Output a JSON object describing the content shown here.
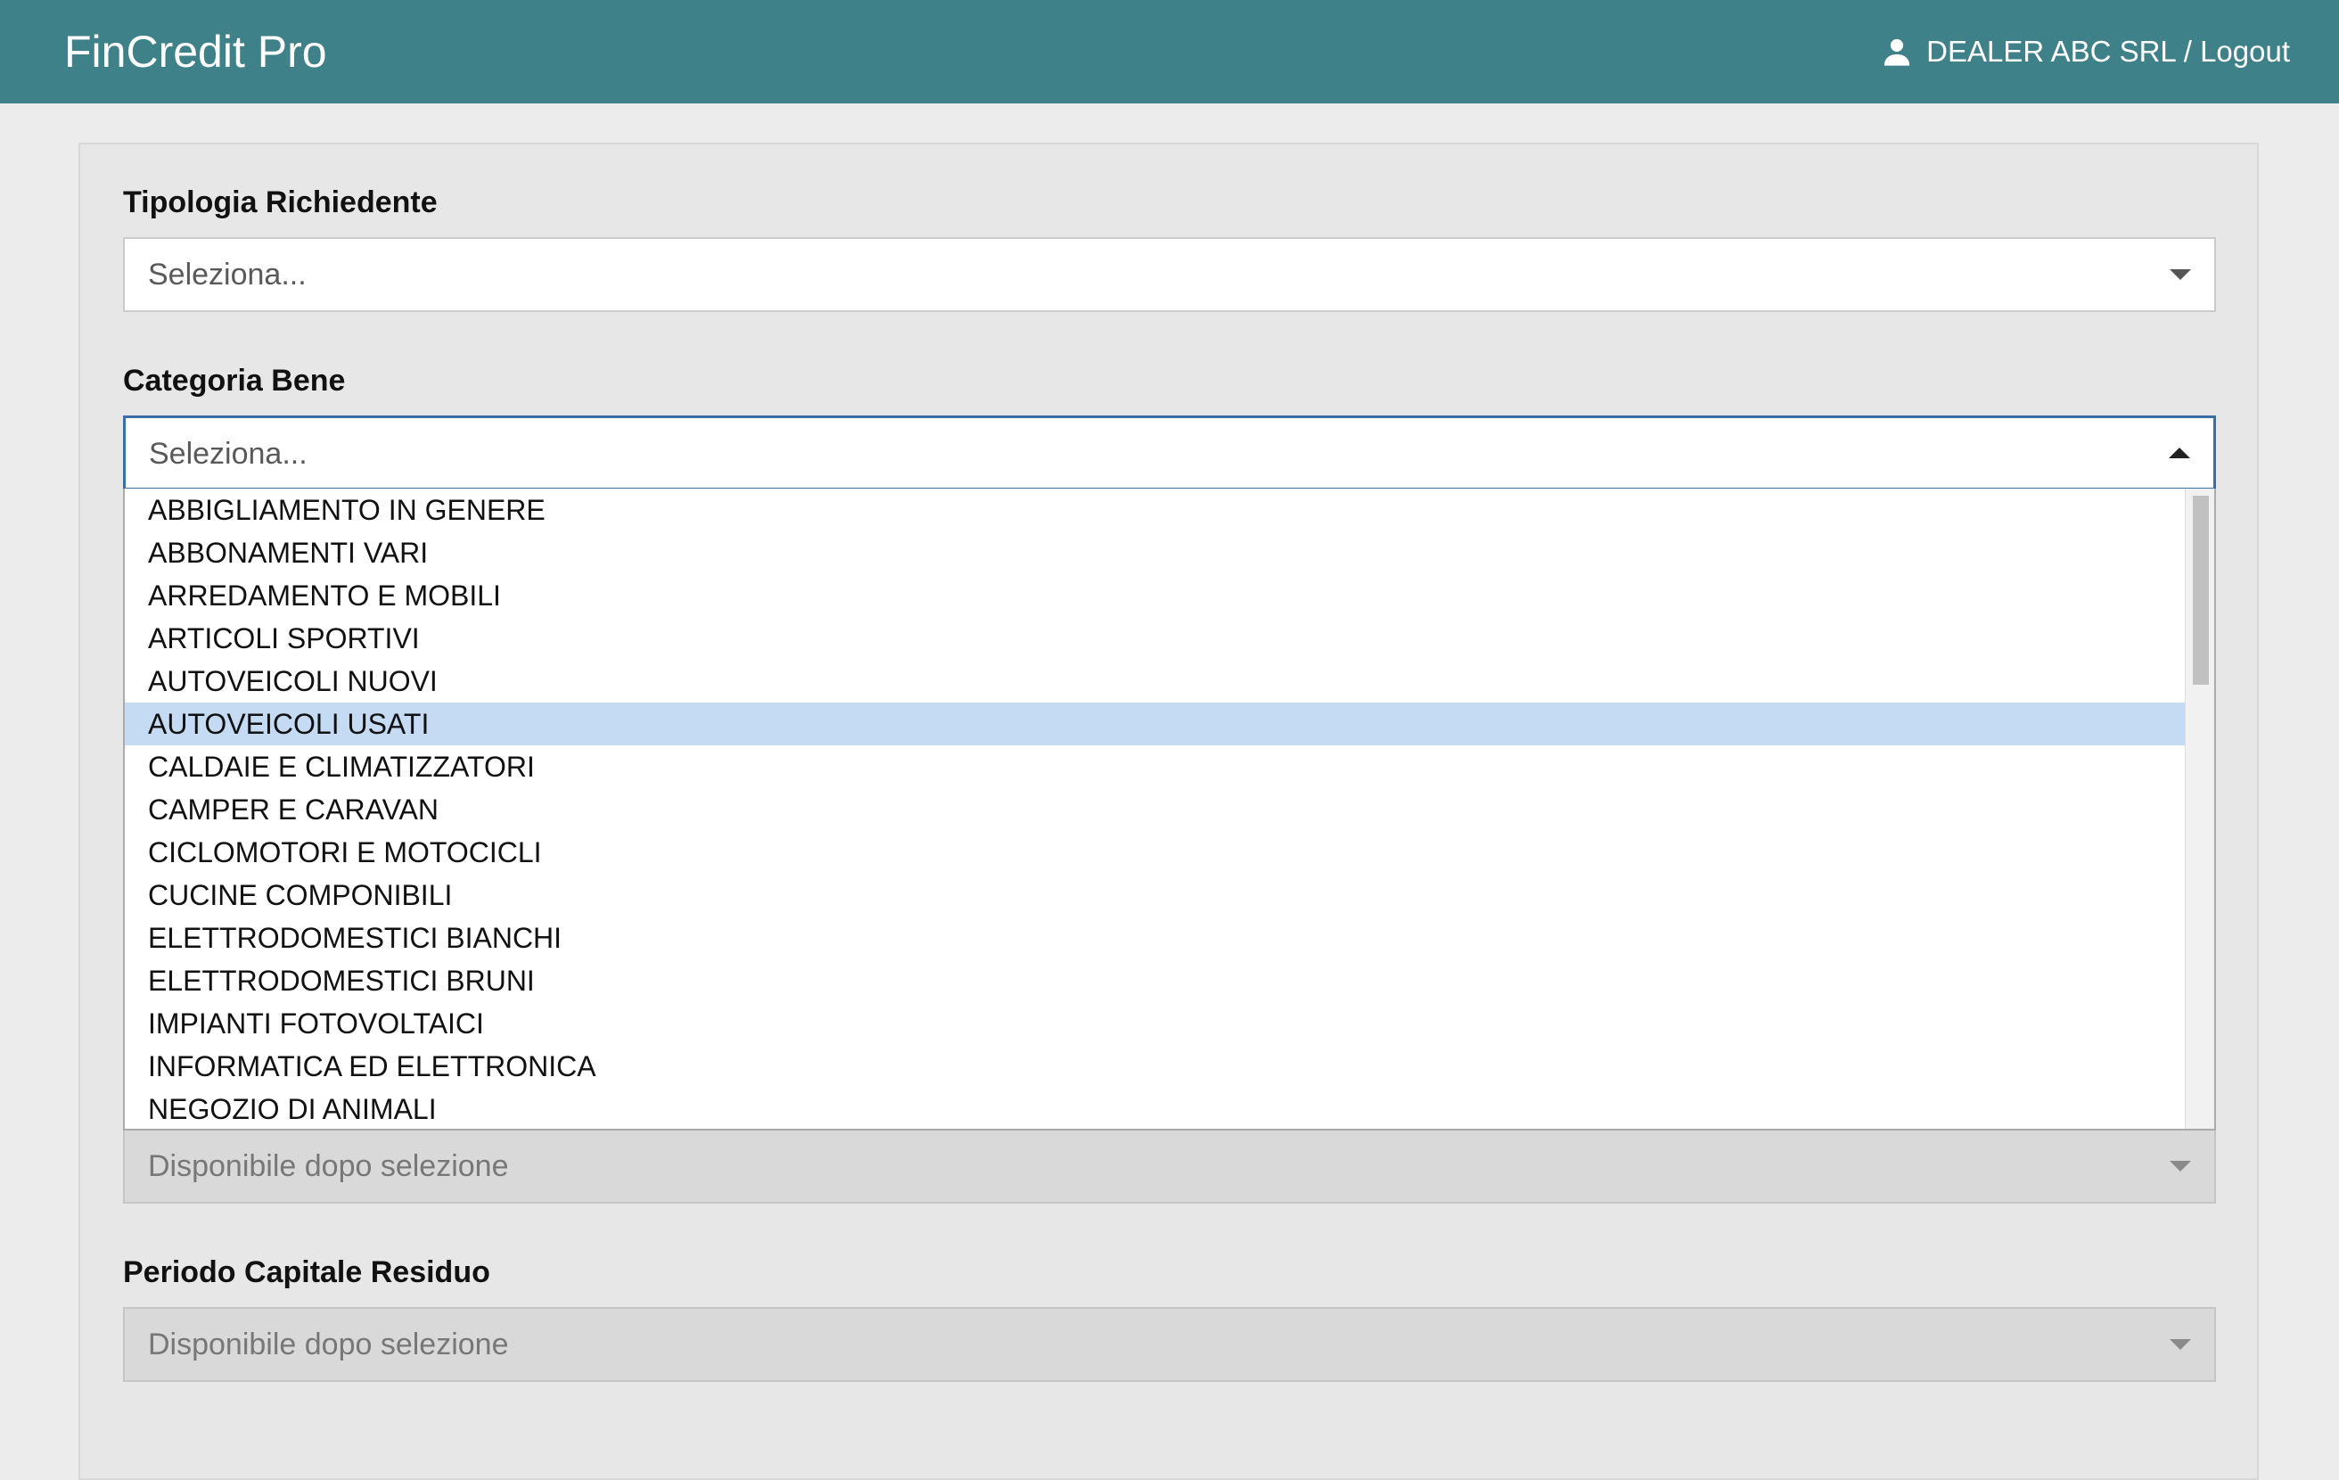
{
  "header": {
    "brand": "FinCredit Pro",
    "user_label": "DEALER ABC SRL / Logout",
    "user_icon": "user-icon",
    "bg_color": "#3f8189"
  },
  "form": {
    "tipologia": {
      "label": "Tipologia Richiedente",
      "value": "Seleziona..."
    },
    "categoria": {
      "label": "Categoria Bene",
      "value": "Seleziona...",
      "options": [
        "ABBIGLIAMENTO IN GENERE",
        "ABBONAMENTI VARI",
        "ARREDAMENTO E MOBILI",
        "ARTICOLI SPORTIVI",
        "AUTOVEICOLI NUOVI",
        "AUTOVEICOLI USATI",
        "CALDAIE E CLIMATIZZATORI",
        "CAMPER E CARAVAN",
        "CICLOMOTORI E MOTOCICLI",
        "CUCINE COMPONIBILI",
        "ELETTRODOMESTICI BIANCHI",
        "ELETTRODOMESTICI BRUNI",
        "IMPIANTI FOTOVOLTAICI",
        "INFORMATICA ED ELETTRONICA",
        "NEGOZIO DI ANIMALI"
      ],
      "highlighted": "AUTOVEICOLI USATI"
    },
    "hidden_field": {
      "value": "Disponibile dopo selezione"
    },
    "periodo": {
      "label": "Periodo Capitale Residuo",
      "value": "Disponibile dopo selezione"
    }
  }
}
